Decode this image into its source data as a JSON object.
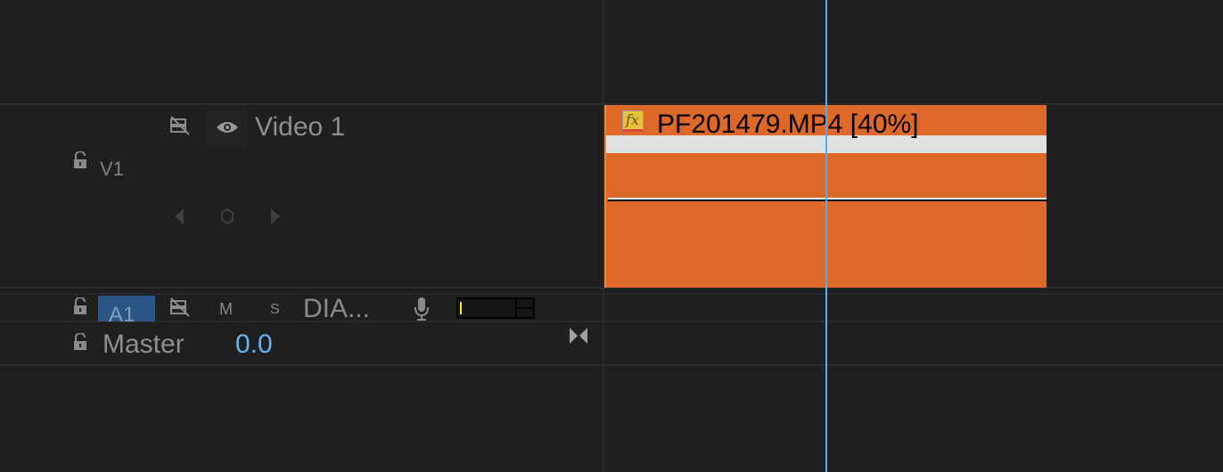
{
  "tracks": {
    "video": {
      "name": "Video 1",
      "id": "V1"
    },
    "audio": {
      "id": "A1",
      "mute": "M",
      "solo": "S",
      "name": "DIA..."
    },
    "master": {
      "name": "Master",
      "value": "0.0"
    }
  },
  "clip": {
    "label": "PF201479.MP4 [40%]",
    "fx_badge": "fx",
    "color": "#dd6827"
  },
  "colors": {
    "playhead": "#5aa9f0",
    "accent": "#2b5584"
  },
  "icons": [
    "sync-lock-icon",
    "eye-icon",
    "lock-icon",
    "prev-keyframe-icon",
    "keyframe-icon",
    "next-keyframe-icon",
    "microphone-icon",
    "audio-meter",
    "expand-icon"
  ]
}
